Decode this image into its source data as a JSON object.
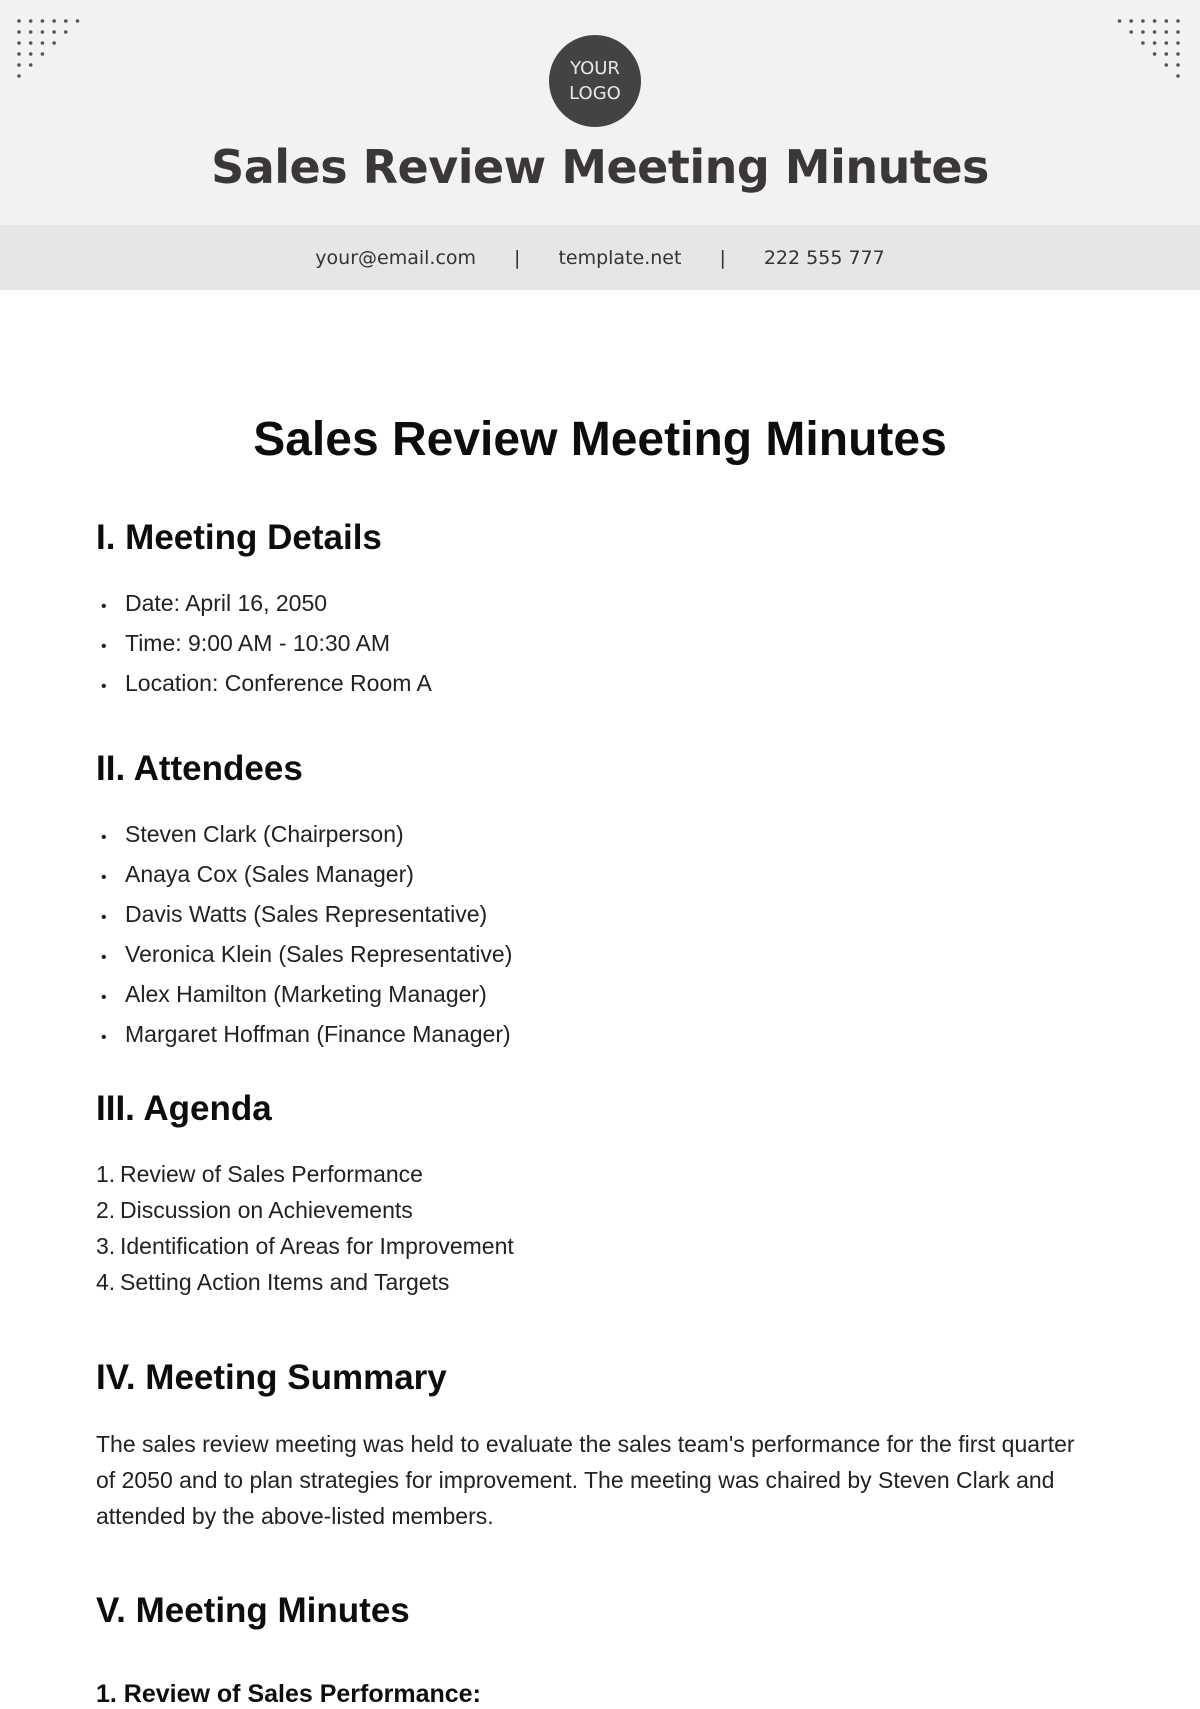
{
  "header": {
    "logo_line1": "YOUR",
    "logo_line2": "LOGO",
    "title": "Sales Review Meeting Minutes",
    "contact": {
      "email": "your@email.com",
      "website": "template.net",
      "phone": "222 555 777",
      "separator": "|"
    }
  },
  "document": {
    "title": "Sales Review Meeting Minutes",
    "sections": {
      "details": {
        "heading": "I. Meeting Details",
        "items": [
          "Date: April 16, 2050",
          "Time: 9:00 AM - 10:30 AM",
          "Location: Conference Room A"
        ]
      },
      "attendees": {
        "heading": "II. Attendees",
        "items": [
          "Steven Clark (Chairperson)",
          "Anaya Cox (Sales Manager)",
          "Davis Watts (Sales Representative)",
          "Veronica Klein (Sales Representative)",
          "Alex Hamilton (Marketing Manager)",
          "Margaret Hoffman (Finance Manager)"
        ]
      },
      "agenda": {
        "heading": "III. Agenda",
        "items": [
          "Review of Sales Performance",
          "Discussion on Achievements",
          "Identification of Areas for Improvement",
          "Setting Action Items and Targets"
        ]
      },
      "summary": {
        "heading": "IV. Meeting Summary",
        "text": "The sales review meeting was held to evaluate the sales team's performance for the first quarter of 2050 and to plan strategies for improvement. The meeting was chaired by Steven Clark and attended by the above-listed members."
      },
      "minutes": {
        "heading": "V. Meeting Minutes",
        "subheading": "1. Review of Sales Performance:"
      }
    }
  }
}
